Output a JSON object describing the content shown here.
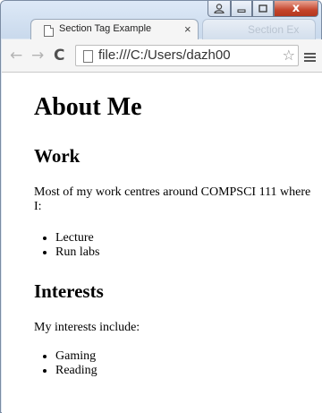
{
  "browser": {
    "tab_title": "Section Tag Example",
    "tab_close": "×",
    "ghost_tab_text": "Section Ex",
    "window_close": "x",
    "url": "file:///C:/Users/dazh00",
    "icons": [
      "page-icon",
      "back-icon",
      "forward-icon",
      "reload-icon",
      "star-icon",
      "menu-icon",
      "user-icon",
      "minimize-icon",
      "maximize-icon",
      "close-icon"
    ]
  },
  "page": {
    "heading": "About Me",
    "work": {
      "heading": "Work",
      "text": "Most of my work centres around COMPSCI 111 where I:",
      "items": [
        "Lecture",
        "Run labs"
      ]
    },
    "interests": {
      "heading": "Interests",
      "text": "My interests include:",
      "items": [
        "Gaming",
        "Reading"
      ]
    }
  }
}
